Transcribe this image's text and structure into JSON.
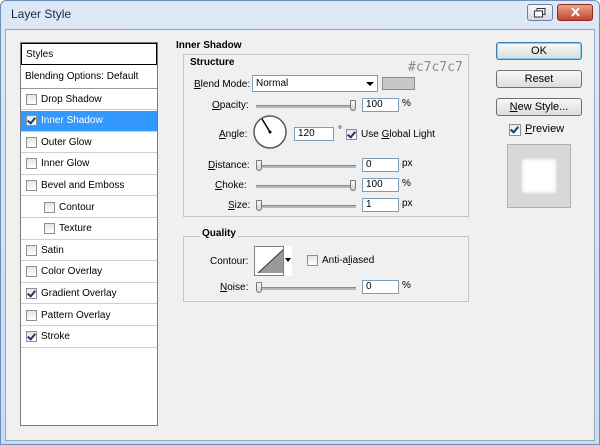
{
  "window": {
    "title": "Layer Style"
  },
  "styles_list": {
    "header": "Styles",
    "blending": "Blending Options: Default",
    "items": [
      {
        "label": "Drop Shadow",
        "checked": false,
        "sub": false,
        "selected": false
      },
      {
        "label": "Inner Shadow",
        "checked": true,
        "sub": false,
        "selected": true
      },
      {
        "label": "Outer Glow",
        "checked": false,
        "sub": false,
        "selected": false
      },
      {
        "label": "Inner Glow",
        "checked": false,
        "sub": false,
        "selected": false
      },
      {
        "label": "Bevel and Emboss",
        "checked": false,
        "sub": false,
        "selected": false
      },
      {
        "label": "Contour",
        "checked": false,
        "sub": true,
        "selected": false
      },
      {
        "label": "Texture",
        "checked": false,
        "sub": true,
        "selected": false
      },
      {
        "label": "Satin",
        "checked": false,
        "sub": false,
        "selected": false
      },
      {
        "label": "Color Overlay",
        "checked": false,
        "sub": false,
        "selected": false
      },
      {
        "label": "Gradient Overlay",
        "checked": true,
        "sub": false,
        "selected": false
      },
      {
        "label": "Pattern Overlay",
        "checked": false,
        "sub": false,
        "selected": false
      },
      {
        "label": "Stroke",
        "checked": true,
        "sub": false,
        "selected": false
      }
    ]
  },
  "inner_shadow": {
    "title": "Inner Shadow",
    "structure": {
      "title": "Structure",
      "blend_mode_label": "Blend Mode:",
      "blend_mode_value": "Normal",
      "color_note": "#c7c7c7",
      "opacity_label": "Opacity:",
      "opacity_value": "100",
      "opacity_level": 1.0,
      "angle_label": "Angle:",
      "angle_value": "120",
      "angle_unit": "°",
      "use_global_light": "Use Global Light",
      "use_global_light_checked": true,
      "distance_label": "Distance:",
      "distance_value": "0",
      "distance_level": 0.0,
      "choke_label": "Choke:",
      "choke_value": "100",
      "choke_level": 1.0,
      "size_label": "Size:",
      "size_value": "1",
      "size_level": 0.0,
      "px": "px",
      "percent": "%"
    },
    "quality": {
      "title": "Quality",
      "contour_label": "Contour:",
      "anti_aliased": "Anti-aliased",
      "anti_aliased_checked": false,
      "noise_label": "Noise:",
      "noise_value": "0",
      "noise_level": 0.0
    }
  },
  "buttons": {
    "ok": "OK",
    "reset": "Reset",
    "new_style": "New Style...",
    "preview": "Preview",
    "preview_checked": true
  },
  "colors": {
    "shadow_color": "#c7c7c7",
    "selection": "#3399ff"
  }
}
